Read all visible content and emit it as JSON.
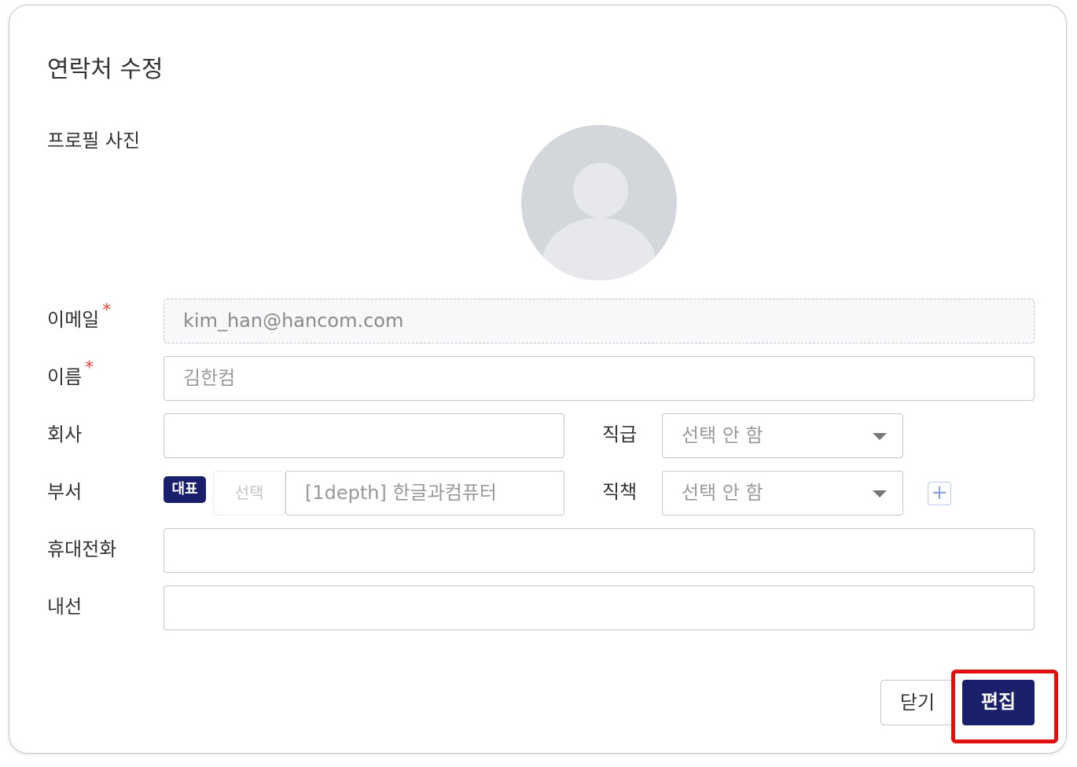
{
  "dialog": {
    "title": "연락처 수정",
    "labels": {
      "photo": "프로필 사진",
      "email": "이메일",
      "name": "이름",
      "company": "회사",
      "rank": "직급",
      "department": "부서",
      "position": "직책",
      "mobile": "휴대전화",
      "extension": "내선"
    },
    "required_mark": "*",
    "email_value": "kim_han@hancom.com",
    "name_placeholder": "김한컴",
    "company_value": "",
    "rank_select": "선택 안 함",
    "department_badge": "대표",
    "department_picker": "선택",
    "department_value": "[1depth] 한글과컴퓨터",
    "position_select": "선택 안 함",
    "add_icon_glyph": "+",
    "mobile_value": "",
    "extension_value": "",
    "buttons": {
      "close": "닫기",
      "edit": "편집"
    },
    "colors": {
      "primary": "#1a1f6b",
      "required": "#e8453c",
      "highlight": "#e01010"
    }
  }
}
